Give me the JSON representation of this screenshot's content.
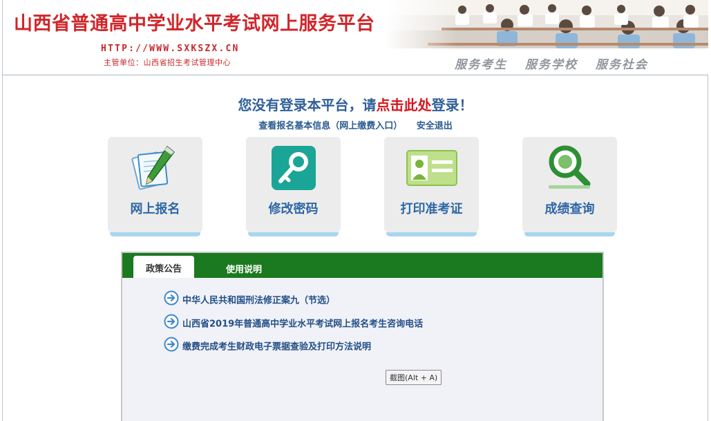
{
  "header": {
    "title": "山西省普通高中学业水平考试网上服务平台",
    "url": "HTTP://WWW.SXKSZX.CN",
    "sponsor": "主管单位：山西省招生考试管理中心",
    "slogans": [
      "服务考生",
      "服务学校",
      "服务社会"
    ]
  },
  "login": {
    "prefix": "您没有登录本平台，请",
    "link": "点击此处",
    "suffix": "登录！"
  },
  "sublinks": {
    "info": "查看报名基本信息（网上缴费入口）",
    "logout": "安全退出"
  },
  "tiles": [
    {
      "label": "网上报名",
      "icon": "pencil-paper-icon"
    },
    {
      "label": "修改密码",
      "icon": "key-icon"
    },
    {
      "label": "打印准考证",
      "icon": "id-card-icon"
    },
    {
      "label": "成绩查询",
      "icon": "magnifier-icon"
    }
  ],
  "tabs": {
    "active": "政策公告",
    "other": "使用说明"
  },
  "notices": [
    "中华人民共和国刑法修正案九（节选）",
    "山西省2019年普通高中学业水平考试网上报名考生咨询电话",
    "缴费完成考生财政电子票据查验及打印方法说明"
  ],
  "tooltip": "截图(Alt + A)",
  "colors": {
    "title_red": "#d0262a",
    "link_blue": "#2f5f97",
    "tab_green": "#1b7a1f",
    "tile_bg": "#ececec",
    "tile_bar": "#a8d6ee"
  }
}
